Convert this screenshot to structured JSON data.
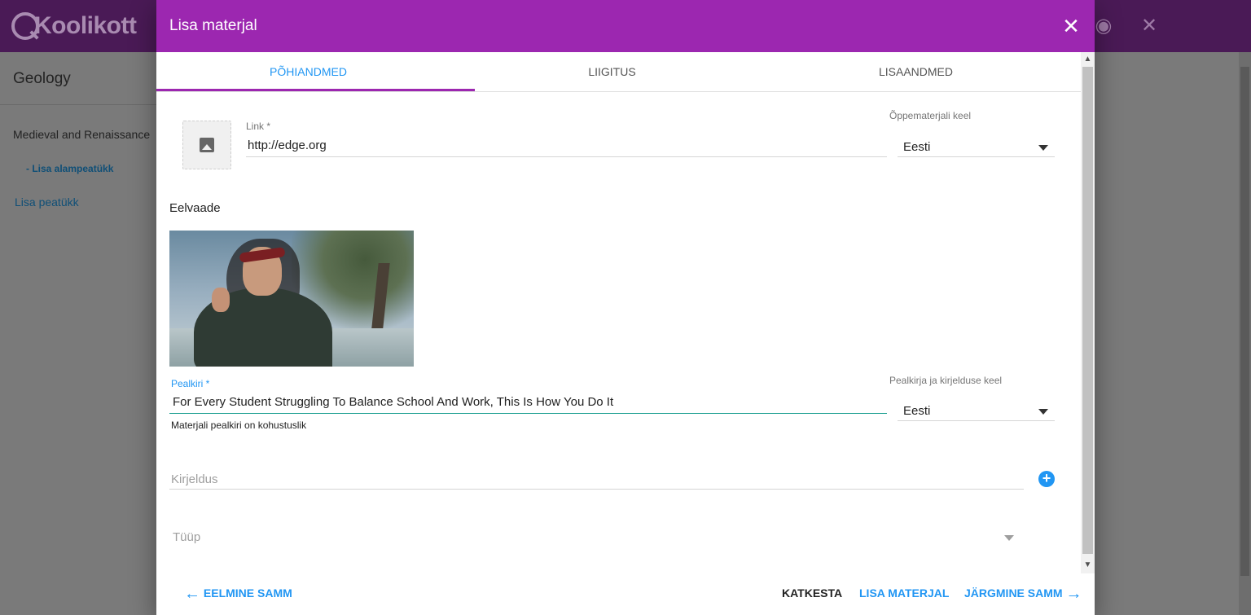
{
  "app": {
    "logo_text": "Koolikott",
    "sidebar_title": "Geology",
    "chapter_title": "Medieval and Renaissance",
    "add_subchapter": "- Lisa alampeatükk",
    "add_chapter": "Lisa peatükk"
  },
  "dialog": {
    "title": "Lisa materjal",
    "tabs": [
      {
        "label": "PÕHIANDMED",
        "active": true
      },
      {
        "label": "LIIGITUS",
        "active": false
      },
      {
        "label": "LISAANDMED",
        "active": false
      }
    ],
    "link": {
      "label": "Link *",
      "value": "http://edge.org"
    },
    "material_language": {
      "label": "Õppematerjali keel",
      "value": "Eesti"
    },
    "preview_label": "Eelvaade",
    "title_field": {
      "label": "Pealkiri *",
      "value": "For Every Student Struggling To Balance School And Work, This Is How You Do It",
      "help": "Materjali pealkiri on kohustuslik"
    },
    "title_language": {
      "label": "Pealkirja ja kirjelduse keel",
      "value": "Eesti"
    },
    "description": {
      "placeholder": "Kirjeldus"
    },
    "type": {
      "placeholder": "Tüüp"
    },
    "footer": {
      "prev": "EELMINE SAMM",
      "cancel": "KATKESTA",
      "add": "LISA MATERJAL",
      "next": "JÄRGMINE SAMM"
    }
  },
  "colors": {
    "header": "#9c27b0",
    "accent": "#2196f3",
    "teal_underline": "#1a9e8f"
  }
}
